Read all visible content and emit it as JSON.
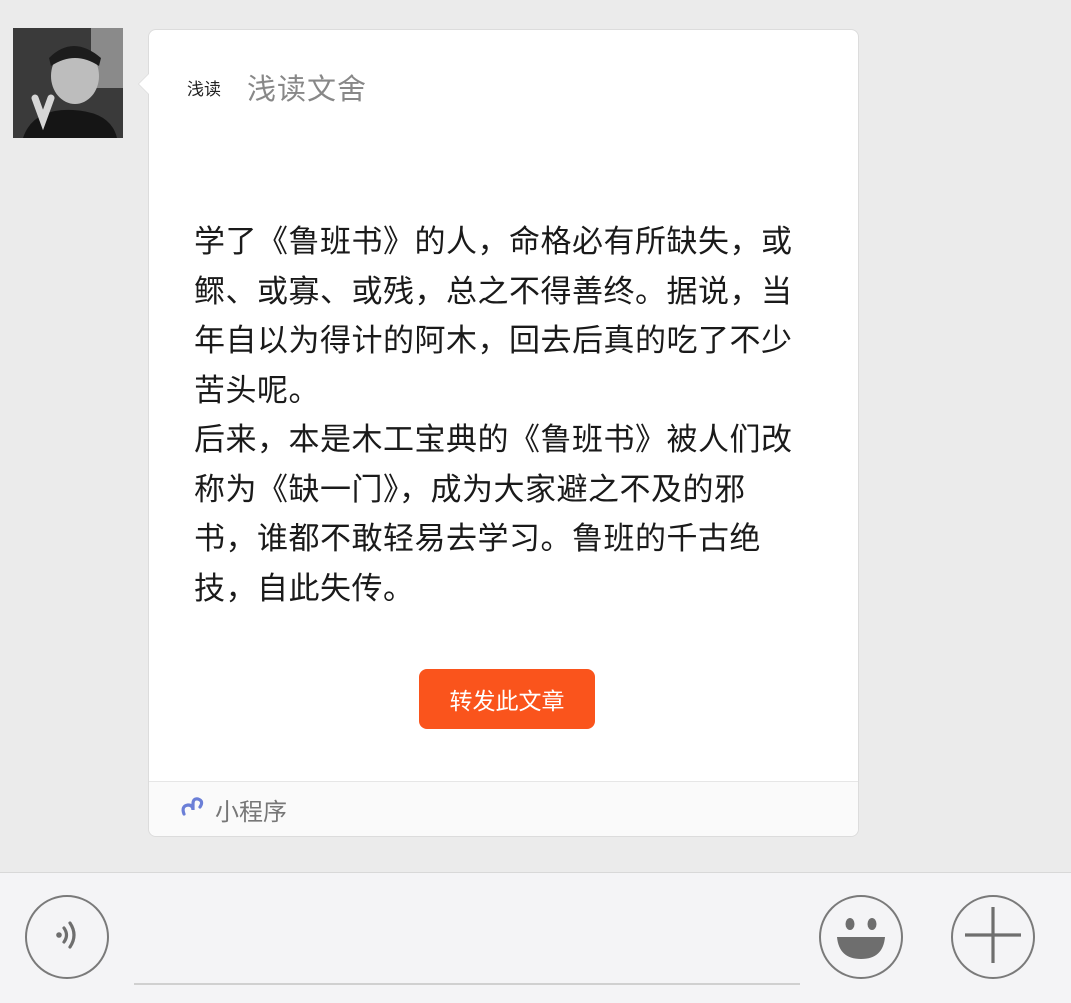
{
  "chat": {
    "avatar_icon": "user-avatar-photo",
    "message": {
      "mini_program_logo_text": "浅读",
      "mini_program_name": "浅读文舍",
      "article_text": "学了《鲁班书》的人，命格必有所缺失，或\n鳏、或寡、或残，总之不得善终。据说，当\n年自以为得计的阿木，回去后真的吃了不少\n苦头呢。\n后来，本是木工宝典的《鲁班书》被人们改\n称为《缺一门》，成为大家避之不及的邪\n书，谁都不敢轻易去学习。鲁班的千古绝\n技，自此失传。",
      "share_button_label": "转发此文章",
      "share_button_color": "#fa541c",
      "footer_icon": "mini-program-link-icon",
      "footer_label": "小程序"
    }
  },
  "input_bar": {
    "voice_icon": "voice-input-icon",
    "text_placeholder": "",
    "emoji_icon": "emoji-smiley-icon",
    "plus_icon": "plus-icon"
  }
}
